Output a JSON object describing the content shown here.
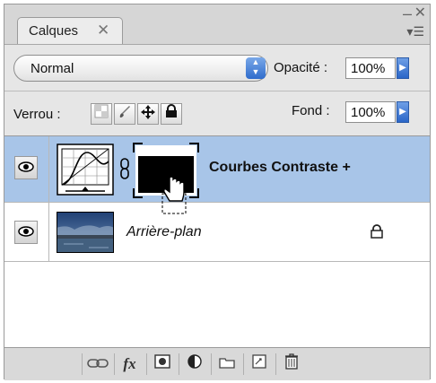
{
  "panel": {
    "tab_label": "Calques",
    "tab_close": "✕",
    "minimize": "–",
    "close": "✕",
    "menu": "▾☰"
  },
  "blend": {
    "mode": "Normal",
    "opacity_label": "Opacité :",
    "opacity_value": "100%"
  },
  "lock": {
    "label": "Verrou :",
    "fill_label": "Fond :",
    "fill_value": "100%"
  },
  "layers": [
    {
      "name": "Courbes Contraste +",
      "type": "adjustment",
      "selected": true,
      "visible": true
    },
    {
      "name": "Arrière-plan",
      "type": "background",
      "selected": false,
      "visible": true,
      "locked": true
    }
  ],
  "bottom_bar": {
    "fx_label": "fx"
  },
  "colors": {
    "selection": "#a8c5e8",
    "accent_blue": "#2f6ccc"
  }
}
